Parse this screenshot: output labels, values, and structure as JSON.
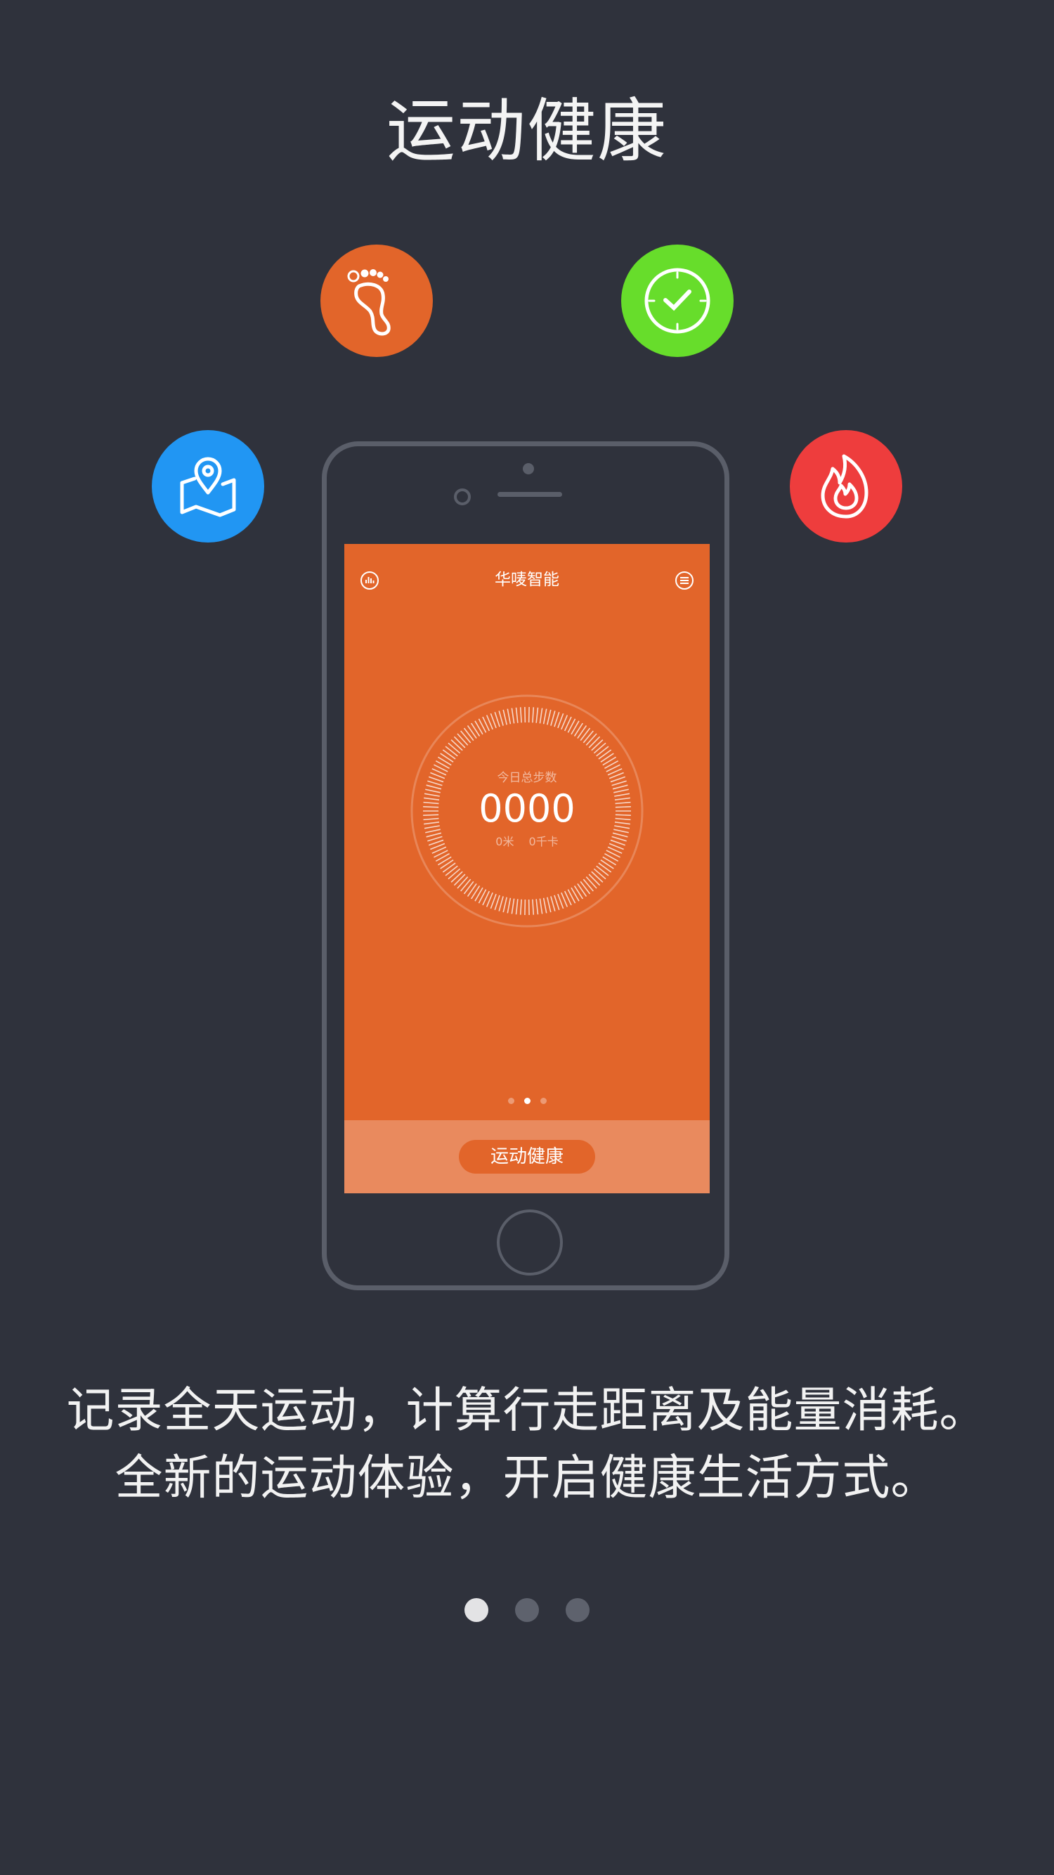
{
  "header": {
    "title": "运动健康"
  },
  "feature_icons": [
    {
      "name": "footprint-icon",
      "color": "#e2652a"
    },
    {
      "name": "clock-check-icon",
      "color": "#67dd2b"
    },
    {
      "name": "map-pin-icon",
      "color": "#2196f3"
    },
    {
      "name": "flame-icon",
      "color": "#ee3d3d"
    }
  ],
  "phone_screen": {
    "app_title": "华唛智能",
    "left_icon": "stats-icon",
    "right_icon": "menu-icon",
    "steps_label": "今日总步数",
    "steps_value": "0000",
    "distance": "0米",
    "calories": "0千卡",
    "page_indicator": {
      "count": 3,
      "active": 1
    },
    "button_label": "运动健康",
    "screen_color": "#e2652a",
    "bar_color": "#e98a5e"
  },
  "description": {
    "line1": "记录全天运动，计算行走距离及能量消耗。",
    "line2": "全新的运动体验，开启健康生活方式。"
  },
  "pager": {
    "count": 3,
    "active": 0
  }
}
